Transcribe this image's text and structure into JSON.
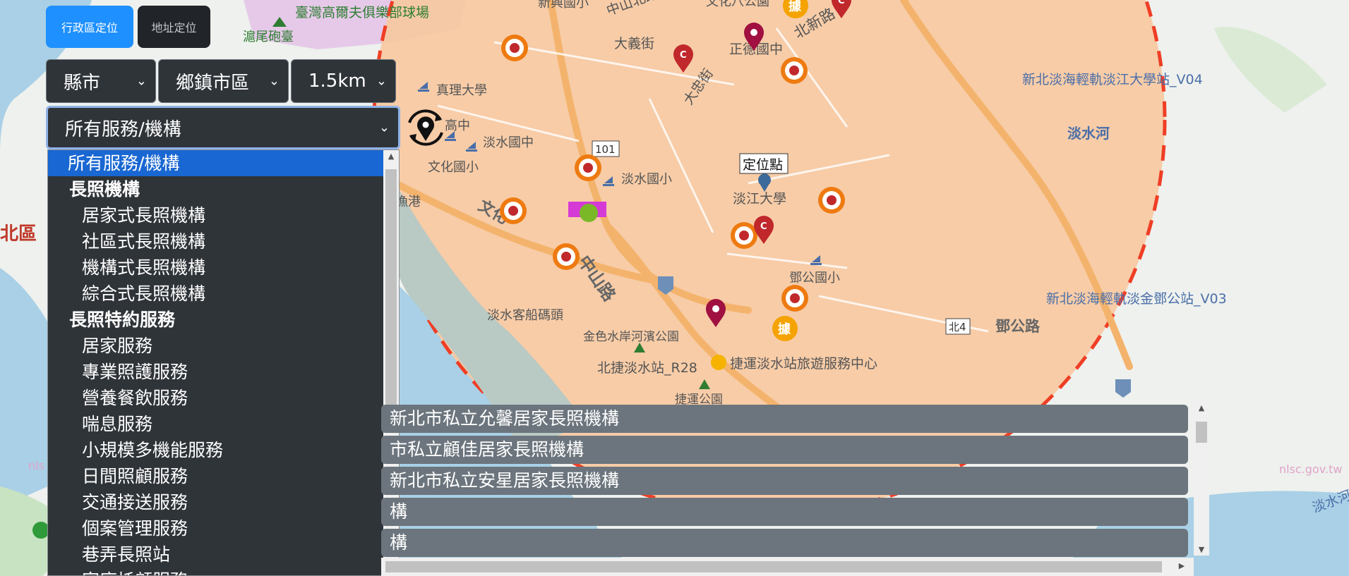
{
  "tabs": {
    "admin": "行政區定位",
    "address": "地址定位"
  },
  "filters": {
    "county": "縣市",
    "township": "鄉鎮市區",
    "radius": "1.5km",
    "service": "所有服務/機構"
  },
  "dropdown_options": [
    {
      "label": "所有服務/機構",
      "kind": "top"
    },
    {
      "label": "長照機構",
      "kind": "group"
    },
    {
      "label": "居家式長照機構",
      "kind": "item"
    },
    {
      "label": "社區式長照機構",
      "kind": "item"
    },
    {
      "label": "機構式長照機構",
      "kind": "item"
    },
    {
      "label": "綜合式長照機構",
      "kind": "item"
    },
    {
      "label": "長照特約服務",
      "kind": "group"
    },
    {
      "label": "居家服務",
      "kind": "item"
    },
    {
      "label": "專業照護服務",
      "kind": "item"
    },
    {
      "label": "營養餐飲服務",
      "kind": "item"
    },
    {
      "label": "喘息服務",
      "kind": "item"
    },
    {
      "label": "小規模多機能服務",
      "kind": "item"
    },
    {
      "label": "日間照顧服務",
      "kind": "item"
    },
    {
      "label": "交通接送服務",
      "kind": "item"
    },
    {
      "label": "個案管理服務",
      "kind": "item"
    },
    {
      "label": "巷弄長照站",
      "kind": "item"
    },
    {
      "label": "家庭托顧服務",
      "kind": "item"
    }
  ],
  "results": [
    "新北市私立允馨居家長照機構",
    "市私立顧佳居家長照機構",
    "新北市私立安星居家長照機構",
    "構",
    "構"
  ],
  "map": {
    "marker_label": "定位點",
    "place_labels": {
      "sports": "臺灣高爾夫俱樂部球場",
      "huwei": "滬尾砲臺",
      "xinxing": "新興國小",
      "zhongshan_n": "中山北路",
      "wenhua8": "文化八公園",
      "beixin": "北新路",
      "dayi": "大義街",
      "zhengde": "正德國中",
      "zhenli": "真理大學",
      "gaozhong": "高中",
      "tamsui_jh": "淡水國中",
      "wenhua_es": "文化國小",
      "tamsui_es": "淡水國小",
      "dazhong": "大忠街",
      "tku": "淡江大學",
      "dengong": "鄧公國小",
      "ferry": "淡水客船碼頭",
      "golden": "金色水岸河濱公園",
      "mrt": "北捷淡水站_R28",
      "visitor": "捷運淡水站旅遊服務中心",
      "zhongshan": "中山路",
      "wenhua_rd": "文化",
      "v04": "新北淡海輕軌淡江大學站_V04",
      "v03": "新北淡海輕軌淡金鄧公站_V03",
      "river": "淡水河",
      "denggong_rd": "鄧公路",
      "north": "北區",
      "port": "漁港",
      "road101": "101",
      "road_bei4": "北4",
      "park": "捷運公園",
      "river2": "淡水河",
      "wm1": "nlsc.gov.tw",
      "wm2": "nls"
    },
    "poi_badge_text": "據",
    "colors": {
      "circle_fill": "#f7c9a2",
      "circle_border": "#ef3e25",
      "water": "#a9d0e6",
      "land": "#eef1ee",
      "marker_orange": "#ee7a10",
      "marker_red": "#c0282c",
      "marker_yellow": "#f5a300"
    }
  }
}
